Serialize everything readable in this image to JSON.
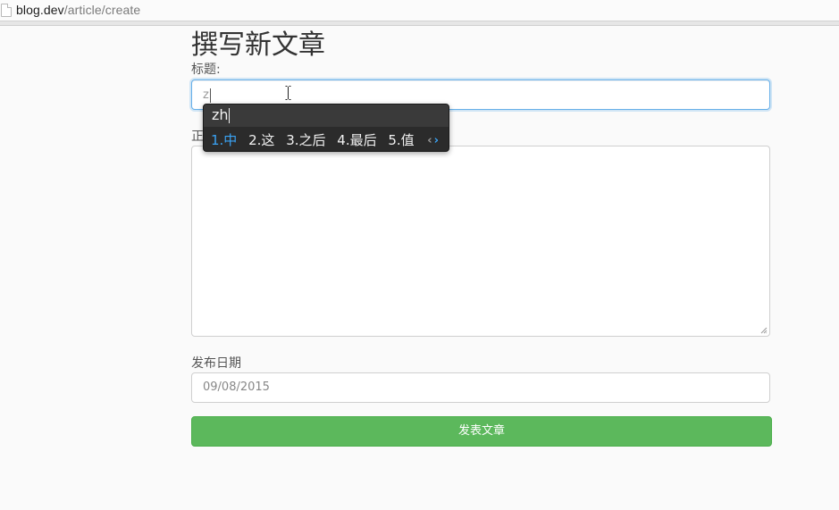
{
  "browser": {
    "url_host": "blog.dev",
    "url_path": "/article/create"
  },
  "page": {
    "title": "撰写新文章"
  },
  "form": {
    "title_label": "标题:",
    "title_value": "z",
    "body_label": "正",
    "date_label": "发布日期",
    "date_value": "09/08/2015",
    "submit_label": "发表文章"
  },
  "ime": {
    "pinyin": "zh",
    "candidates": [
      "1.中",
      "2.这",
      "3.之后",
      "4.最后",
      "5.值"
    ],
    "selected_index": 0,
    "prev_icon": "chevron-left-icon",
    "next_icon": "chevron-right-icon"
  },
  "colors": {
    "accent": "#66afe9",
    "submit_bg": "#5cb85c",
    "ime_highlight": "#3aa3f5"
  }
}
